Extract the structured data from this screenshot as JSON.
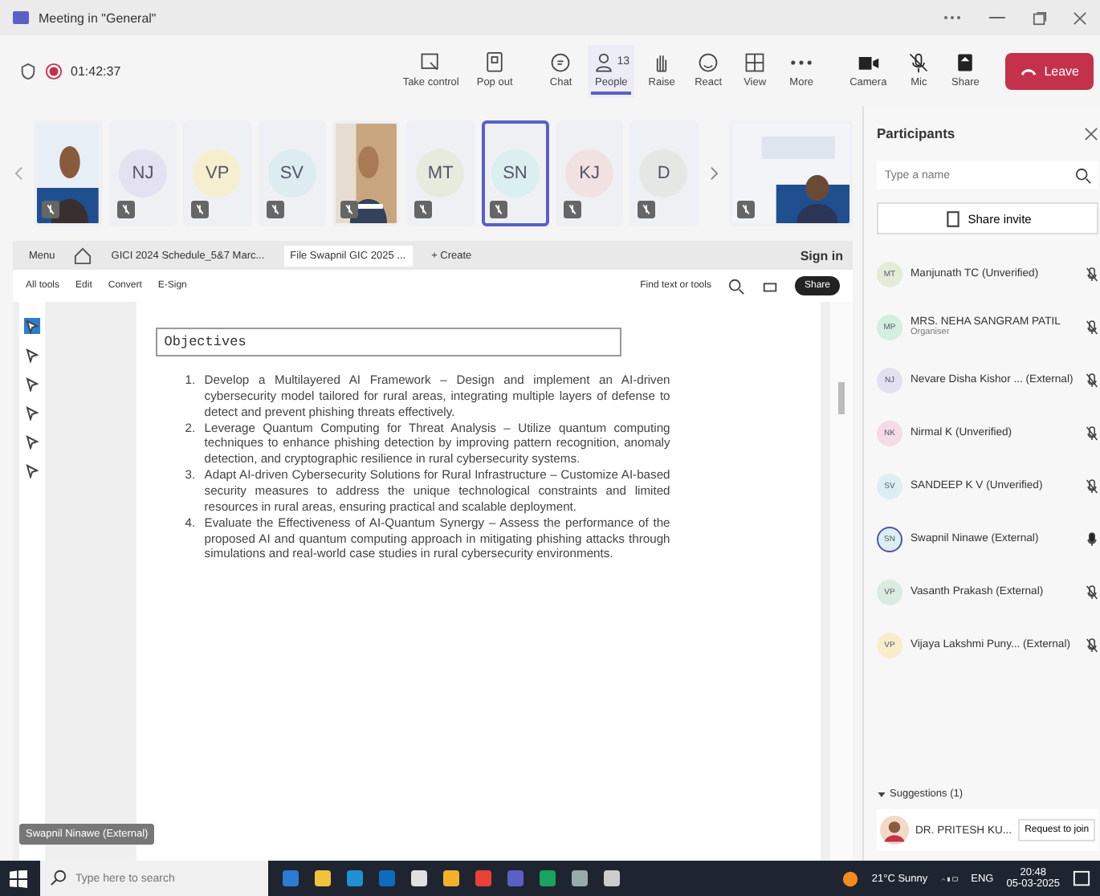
{
  "window": {
    "title": "Meeting in \"General\""
  },
  "meeting": {
    "timer": "01:42:37",
    "recording": true
  },
  "toolbar": [
    {
      "kind": "screen",
      "label": "Take control",
      "open": false
    },
    {
      "kind": "popout",
      "label": "Pop out",
      "open": false
    },
    {
      "kind": "chat",
      "label": "Chat",
      "open": false
    },
    {
      "kind": "people",
      "label": "People",
      "count": "13",
      "open": true
    },
    {
      "kind": "hand",
      "label": "Raise",
      "open": false
    },
    {
      "kind": "emoji",
      "label": "React",
      "open": false
    },
    {
      "kind": "grid",
      "label": "View",
      "open": false
    },
    {
      "kind": "more",
      "label": "More",
      "open": false
    },
    {
      "kind": "camera",
      "label": "Camera",
      "open": false
    },
    {
      "kind": "mic",
      "label": "Mic",
      "open": false
    },
    {
      "kind": "share",
      "label": "Share",
      "open": false
    },
    {
      "kind": "leave",
      "label": "Leave"
    }
  ],
  "video_strip": [
    {
      "kind": "picture",
      "selected": false
    },
    {
      "kind": "avatar",
      "initials": "NJ",
      "color": "#e4e1f2",
      "selected": false
    },
    {
      "kind": "avatar",
      "initials": "VP",
      "color": "#f6efcf",
      "selected": false
    },
    {
      "kind": "avatar",
      "initials": "SV",
      "color": "#dcecf0",
      "selected": false
    },
    {
      "kind": "picture",
      "selected": false
    },
    {
      "kind": "avatar",
      "initials": "MT",
      "color": "#e5ecdd",
      "selected": false
    },
    {
      "kind": "avatar",
      "initials": "SN",
      "color": "#dbeef0",
      "selected": true
    },
    {
      "kind": "avatar",
      "initials": "KJ",
      "color": "#f2e1e1",
      "selected": false
    },
    {
      "kind": "avatar",
      "initials": "D",
      "color": "#e4e8e4",
      "selected": false
    }
  ],
  "browser": {
    "tabs": [
      {
        "label": "Menu",
        "selected": false
      },
      {
        "label": "GICI 2024 Schedule_5&7 Marc...",
        "selected": false
      },
      {
        "label": "File Swapnil GIC 2025 ...",
        "selected": true
      },
      {
        "label": "+ Create",
        "selected": false
      }
    ],
    "sign_in": "Sign in",
    "tools": [
      "All tools",
      "Edit",
      "Convert",
      "E-Sign"
    ],
    "find": "Find text or tools",
    "share": "Share"
  },
  "document": {
    "heading": "Objectives",
    "items": [
      {
        "number": "1.",
        "text": "Develop a Multilayered AI Framework – Design and implement an AI-driven cybersecurity model tailored for rural areas, integrating multiple layers of defense to detect and prevent phishing threats effectively."
      },
      {
        "number": "2.",
        "text": "Leverage Quantum Computing for Threat Analysis – Utilize quantum computing techniques to enhance phishing detection by improving pattern recognition, anomaly detection, and cryptographic resilience in rural cybersecurity systems."
      },
      {
        "number": "3.",
        "text": "Adapt AI-driven Cybersecurity Solutions for Rural Infrastructure – Customize AI-based security measures to address the unique technological constraints and limited resources in rural areas, ensuring practical and scalable deployment."
      },
      {
        "number": "4.",
        "text": "Evaluate the Effectiveness of AI-Quantum Synergy – Assess the performance of the proposed AI and quantum computing approach in mitigating phishing attacks through simulations and real-world case studies in rural cybersecurity environments."
      }
    ]
  },
  "speaker_label": "Swapnil Ninawe (External)",
  "participants": {
    "title": "Participants",
    "search": {
      "placeholder": "Type a name"
    },
    "share_invite": "Share invite",
    "items": [
      {
        "initials": "MT",
        "name": "Manjunath TC (Unverified)",
        "color": "#e3ecd6",
        "muted": true,
        "speaking": false
      },
      {
        "initials": "MP",
        "name": "MRS. NEHA SANGRAM PATIL",
        "role": "Organiser",
        "color": "#d3efe0",
        "muted": true,
        "speaking": false
      },
      {
        "initials": "NJ",
        "name": "Nevare Disha Kishor ... (External)",
        "color": "#e3e0f2",
        "muted": true,
        "speaking": false
      },
      {
        "initials": "NK",
        "name": "Nirmal K (Unverified)",
        "color": "#f5dbe6",
        "muted": true,
        "speaking": false
      },
      {
        "initials": "SV",
        "name": "SANDEEP K V (Unverified)",
        "color": "#dbeef4",
        "muted": true,
        "speaking": false
      },
      {
        "initials": "SN",
        "name": "Swapnil Ninawe (External)",
        "color": "#dbeef0",
        "muted": false,
        "speaking": true
      },
      {
        "initials": "VP",
        "name": "Vasanth Prakash (External)",
        "color": "#d9ecdf",
        "muted": true,
        "speaking": false
      },
      {
        "initials": "VP",
        "name": "Vijaya Lakshmi Puny... (External)",
        "color": "#f8eccb",
        "muted": true,
        "speaking": false
      }
    ],
    "suggestions": {
      "label": "Suggestions (1)",
      "expanded": true,
      "name": "DR. PRITESH KU...",
      "action": "Request to join"
    }
  },
  "taskbar": {
    "search": {
      "placeholder": "Type here to search"
    },
    "weather": "21°C Sunny",
    "language": "ENG",
    "time": "20:48",
    "date": "05-03-2025"
  }
}
